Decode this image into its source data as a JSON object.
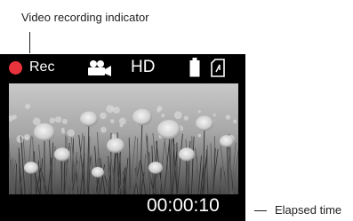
{
  "callouts": {
    "recording_indicator": "Video recording indicator",
    "elapsed_time": "Elapsed time"
  },
  "status_bar": {
    "rec_label": "Rec",
    "rec_color": "#e8323c",
    "mode_icon": "video-camera-icon",
    "quality_label": "HD",
    "battery_icon": "battery-icon",
    "storage_icon": "memory-card-icon"
  },
  "viewfinder": {
    "scene": "photo-of-flower-meadow"
  },
  "elapsed_time": "00:00:10"
}
